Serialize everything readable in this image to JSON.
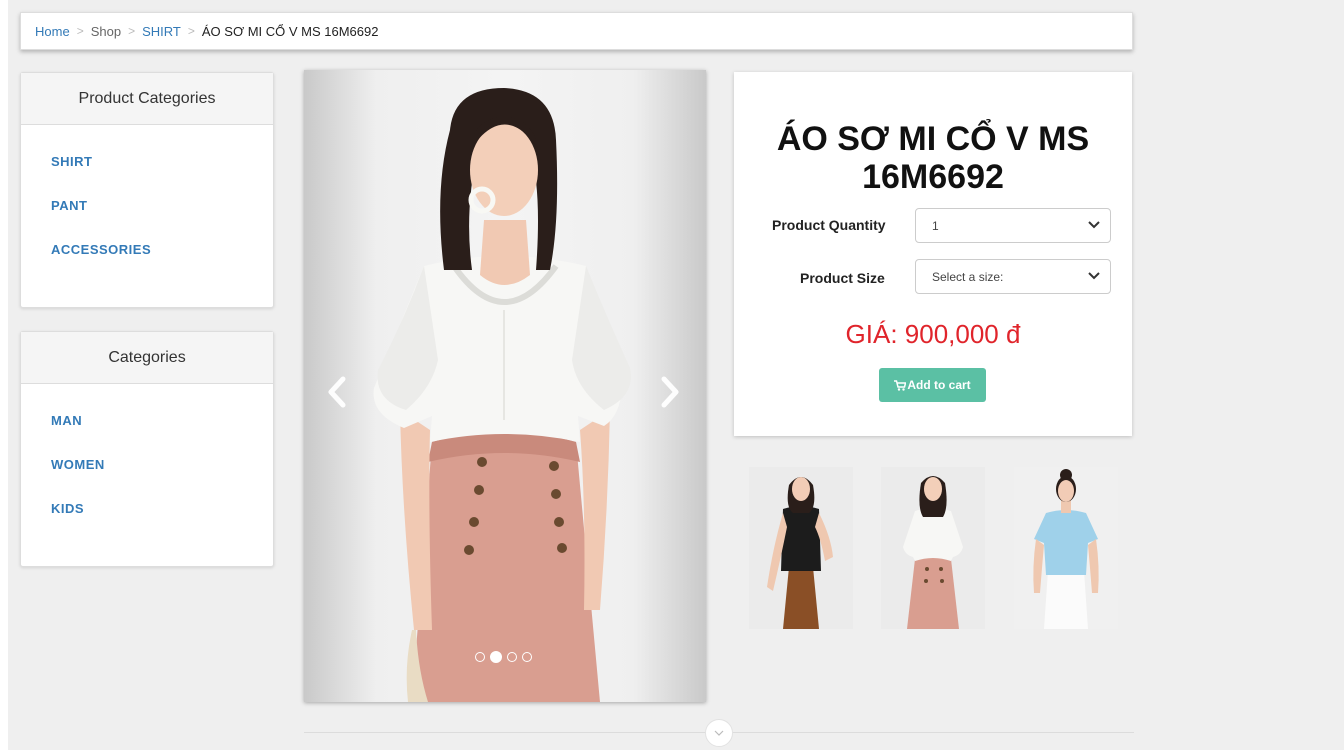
{
  "breadcrumb": {
    "home": "Home",
    "shop": "Shop",
    "category": "SHIRT",
    "current": "ÁO SƠ MI CỔ V MS 16M6692",
    "separator": ">"
  },
  "product_categories": {
    "title": "Product Categories",
    "items": [
      "SHIRT",
      "PANT",
      "ACCESSORIES"
    ]
  },
  "categories": {
    "title": "Categories",
    "items": [
      "MAN",
      "WOMEN",
      "KIDS"
    ]
  },
  "carousel": {
    "slide_count": 4,
    "active_slide": 2
  },
  "product": {
    "title": "ÁO SƠ MI CỔ V MS 16M6692",
    "quantity_label": "Product Quantity",
    "quantity_value": "1",
    "size_label": "Product Size",
    "size_placeholder": "Select a size:",
    "price": "GIÁ: 900,000 đ",
    "add_to_cart": "Add to cart"
  },
  "colors": {
    "link": "#337ab7",
    "price": "#e0242b",
    "button": "#5bc0a4"
  },
  "icons": {
    "carousel_prev": "chevron-left-icon",
    "carousel_next": "chevron-right-icon",
    "cart": "cart-icon",
    "select": "chevron-down-icon",
    "scroll": "chevron-down-icon"
  }
}
